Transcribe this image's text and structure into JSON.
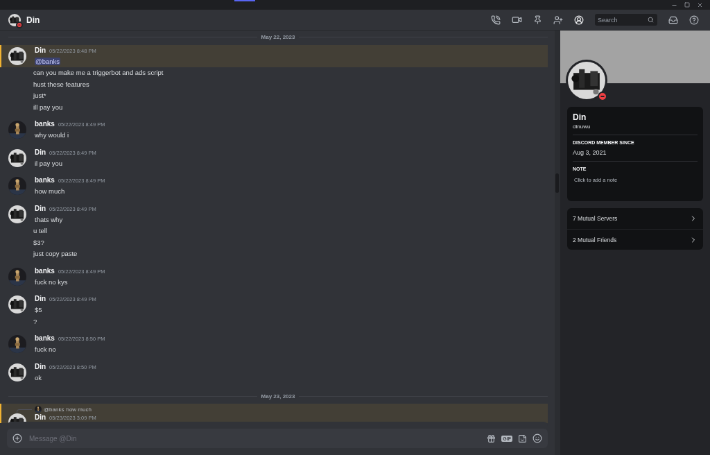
{
  "header": {
    "title": "Din",
    "search": {
      "placeholder": "Search"
    }
  },
  "messages": [
    {
      "kind": "divider",
      "label": "May 22, 2023"
    },
    {
      "kind": "group",
      "author": "Din",
      "time": "05/22/2023 8:48 PM",
      "highlighted": true,
      "lines": [
        {
          "kind": "mention",
          "text": "@banks"
        },
        {
          "kind": "text",
          "text": "can you make me a triggerbot and ads script"
        },
        {
          "kind": "text",
          "text": "hust these features"
        },
        {
          "kind": "text",
          "text": "just*"
        },
        {
          "kind": "text",
          "text": "ill pay you"
        }
      ]
    },
    {
      "kind": "group",
      "author": "banks",
      "time": "05/22/2023 8:49 PM",
      "highlighted": false,
      "lines": [
        {
          "kind": "text",
          "text": "why would i"
        }
      ]
    },
    {
      "kind": "group",
      "author": "Din",
      "time": "05/22/2023 8:49 PM",
      "highlighted": false,
      "lines": [
        {
          "kind": "text",
          "text": "il pay you"
        }
      ]
    },
    {
      "kind": "group",
      "author": "banks",
      "time": "05/22/2023 8:49 PM",
      "highlighted": false,
      "lines": [
        {
          "kind": "text",
          "text": "how much"
        }
      ]
    },
    {
      "kind": "group",
      "author": "Din",
      "time": "05/22/2023 8:49 PM",
      "highlighted": false,
      "lines": [
        {
          "kind": "text",
          "text": "thats why"
        },
        {
          "kind": "text",
          "text": "u tell"
        },
        {
          "kind": "text",
          "text": "$3?"
        },
        {
          "kind": "text",
          "text": "just copy paste"
        }
      ]
    },
    {
      "kind": "group",
      "author": "banks",
      "time": "05/22/2023 8:49 PM",
      "highlighted": false,
      "lines": [
        {
          "kind": "text",
          "text": "fuck no kys"
        }
      ]
    },
    {
      "kind": "group",
      "author": "Din",
      "time": "05/22/2023 8:49 PM",
      "highlighted": false,
      "lines": [
        {
          "kind": "text",
          "text": "$5"
        },
        {
          "kind": "text",
          "text": "?"
        }
      ]
    },
    {
      "kind": "group",
      "author": "banks",
      "time": "05/22/2023 8:50 PM",
      "highlighted": false,
      "lines": [
        {
          "kind": "text",
          "text": "fuck no"
        }
      ]
    },
    {
      "kind": "group",
      "author": "Din",
      "time": "05/22/2023 8:50 PM",
      "highlighted": false,
      "lines": [
        {
          "kind": "text",
          "text": "ok"
        }
      ]
    },
    {
      "kind": "divider",
      "label": "May 23, 2023"
    },
    {
      "kind": "group",
      "author": "Din",
      "time": "05/23/2023 3:09 PM",
      "highlighted": true,
      "reply": {
        "mention": "@banks",
        "text": "how much"
      }
    }
  ],
  "composer": {
    "placeholder": "Message @Din",
    "gif_label": "GIF"
  },
  "profile": {
    "name": "Din",
    "username": "dinuwu",
    "sections": [
      {
        "heading": "DISCORD MEMBER SINCE",
        "value": "Aug 3, 2021"
      }
    ],
    "note": {
      "heading": "NOTE",
      "placeholder": "Click to add a note"
    },
    "links": [
      "7 Mutual Servers",
      "2 Mutual Friends"
    ]
  }
}
